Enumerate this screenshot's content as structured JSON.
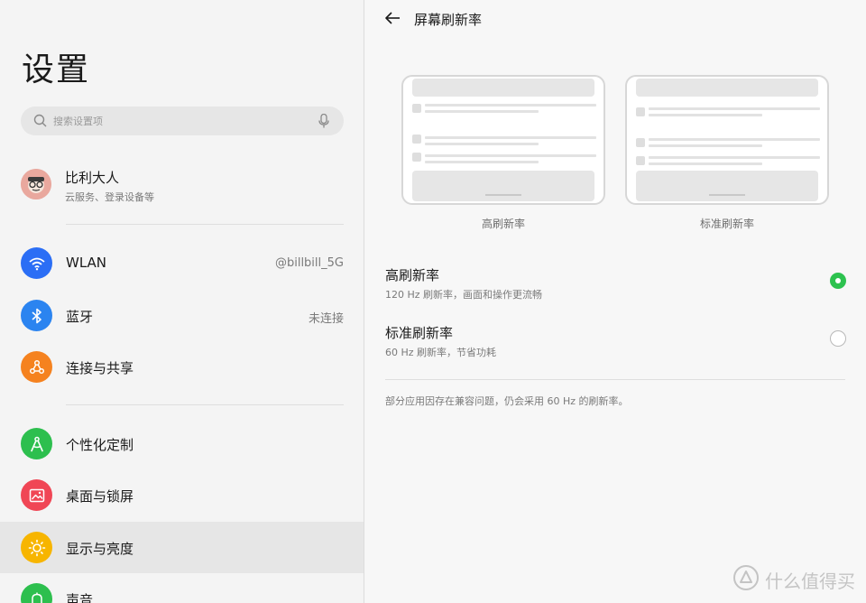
{
  "sidebar": {
    "title": "设置",
    "search_placeholder": "搜索设置项",
    "account": {
      "name": "比利大人",
      "subtitle": "云服务、登录设备等"
    },
    "items": [
      {
        "label": "WLAN",
        "value": "@billbill_5G",
        "icon": "wifi-icon",
        "color": "#2b6ef5"
      },
      {
        "label": "蓝牙",
        "value": "未连接",
        "icon": "bluetooth-icon",
        "color": "#2b84f0"
      },
      {
        "label": "连接与共享",
        "value": "",
        "icon": "share-icon",
        "color": "#f5821f"
      },
      {
        "label": "个性化定制",
        "value": "",
        "icon": "personalize-icon",
        "color": "#2dbf4e"
      },
      {
        "label": "桌面与锁屏",
        "value": "",
        "icon": "wallpaper-icon",
        "color": "#f04655"
      },
      {
        "label": "显示与亮度",
        "value": "",
        "icon": "brightness-icon",
        "color": "#f7b500",
        "active": true
      },
      {
        "label": "声音",
        "value": "",
        "icon": "bell-icon",
        "color": "#2dbf4e"
      }
    ]
  },
  "detail": {
    "title": "屏幕刷新率",
    "previews": [
      {
        "caption": "高刷新率"
      },
      {
        "caption": "标准刷新率"
      }
    ],
    "options": [
      {
        "title": "高刷新率",
        "desc": "120 Hz 刷新率，画面和操作更流畅",
        "selected": true
      },
      {
        "title": "标准刷新率",
        "desc": "60 Hz 刷新率，节省功耗",
        "selected": false
      }
    ],
    "note": "部分应用因存在兼容问题，仍会采用 60 Hz 的刷新率。"
  },
  "watermark": {
    "text": "什么值得买"
  },
  "colors": {
    "accent_green": "#2dc24f"
  }
}
